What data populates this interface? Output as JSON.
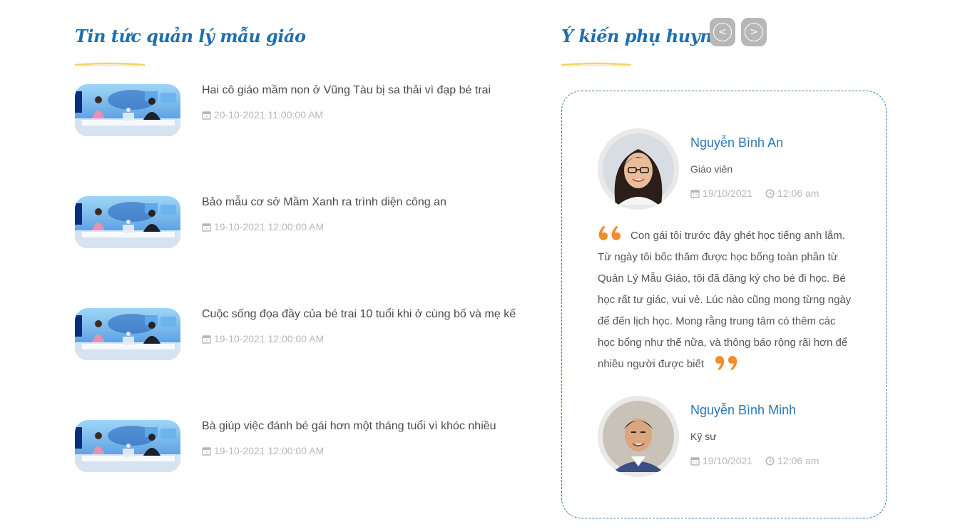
{
  "news_section": {
    "title": "Tin tức quản lý mẫu giáo",
    "items": [
      {
        "title": "Hai cô giáo mầm non ở Vũng Tàu bị sa thải vì đạp bé trai",
        "date": "20-10-2021 11:00:00 AM"
      },
      {
        "title": "Bảo mẫu cơ sở Mầm Xanh ra trình diện công an",
        "date": "19-10-2021 12:00:00 AM"
      },
      {
        "title": "Cuộc sống đọa đầy của bé trai 10 tuổi khi ở cùng bố và mẹ kế",
        "date": "19-10-2021 12:00:00 AM"
      },
      {
        "title": "Bà giúp việc đánh bé gái hơn một tháng tuổi vì khóc nhiều",
        "date": "19-10-2021 12:00:00 AM"
      }
    ]
  },
  "testimonials_section": {
    "title": "Ý kiến phụ huynh",
    "prev_label": "<",
    "next_label": ">",
    "items": [
      {
        "name": "Nguyễn Bình An",
        "role": "Giáo viên",
        "date": "19/10/2021",
        "time": "12:06 am",
        "quote": "Con gái tôi trước đây ghét học tiếng anh lắm. Từ ngày tôi bốc thăm được học bổng toàn phần từ Quản Lý Mẫu Giáo, tôi đã đăng ký cho bé đi học. Bé học rất tư giác, vui vẻ. Lúc nào cũng mong từng ngày để đến lịch học. Mong rằng trung tâm có thêm các học bổng như thế nữa, và thông báo rộng rãi hơn để nhiều người được biết"
      },
      {
        "name": "Nguyễn Bình Minh",
        "role": "Kỹ sư",
        "date": "19/10/2021",
        "time": "12:06 am"
      }
    ]
  },
  "colors": {
    "heading": "#1e6fae",
    "link": "#2a78b9",
    "quote_mark": "#f08c2a",
    "underline": "#f2d36b",
    "muted": "#b8b8b8"
  },
  "icons": {
    "date": "calendar-icon",
    "time": "clock-icon",
    "quote_open": "quote-open-icon",
    "quote_close": "quote-close-icon"
  }
}
